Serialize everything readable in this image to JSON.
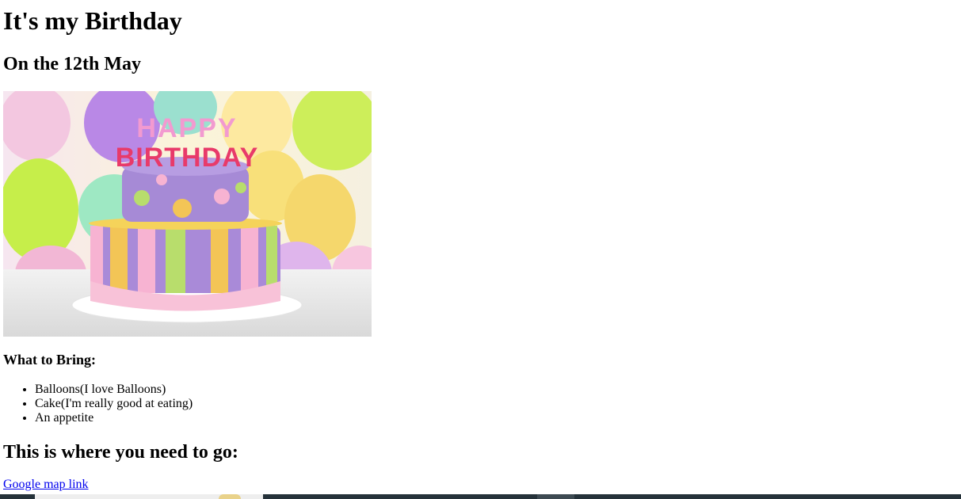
{
  "page": {
    "title": "It's my Birthday",
    "subtitle": "On the 12th May",
    "image_alt": "Birthday cake with HAPPY BIRTHDAY candles",
    "cake_candles": {
      "line1": "HAPPY",
      "line2": "BIRTHDAY"
    },
    "bring_heading": "What to Bring:",
    "bring_items": [
      "Balloons(I love Balloons)",
      "Cake(I'm really good at eating)",
      "An appetite"
    ],
    "where_heading": "This is where you need to go:",
    "map_link_text": "Google map link"
  },
  "colors": {
    "link": "#0000ee",
    "bottom_bar": "#25323a"
  }
}
